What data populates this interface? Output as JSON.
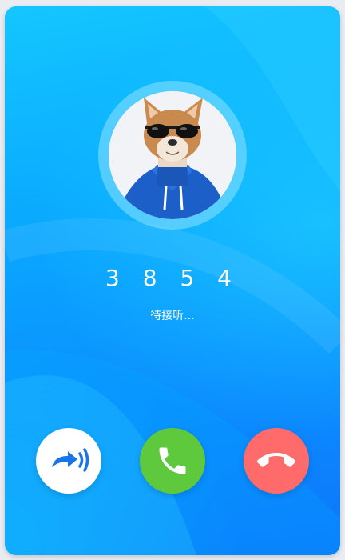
{
  "call": {
    "number": "3 8 5 4",
    "status": "待接听..."
  },
  "icons": {
    "forward": "forward-call-icon",
    "answer": "phone-answer-icon",
    "decline": "phone-hangup-icon"
  },
  "colors": {
    "background_top": "#14c6ff",
    "background_bottom": "#0c76fb",
    "answer": "#5fc93d",
    "decline": "#ff6b6b",
    "forward_icon": "#1a73e8"
  }
}
